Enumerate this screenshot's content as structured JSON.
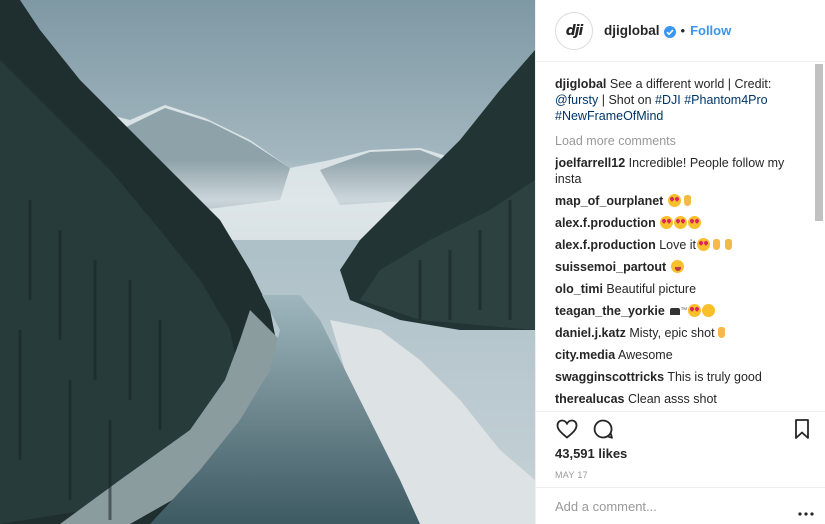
{
  "post": {
    "username": "djiglobal",
    "avatar_text": "dji",
    "follow_label": "Follow",
    "separator": "•",
    "caption_user": "djiglobal",
    "caption_text": "See a different world | Credit:",
    "caption_mention": "@fursty",
    "caption_mid": "| Shot on",
    "caption_tags": [
      "#DJI",
      "#Phantom4Pro",
      "#NewFrameOfMind"
    ],
    "load_more": "Load more comments",
    "likes": "43,591 likes",
    "date": "MAY 17",
    "add_comment_placeholder": "Add a comment..."
  },
  "comments": [
    {
      "user": "joelfarrell12",
      "text": "Incredible! People follow my insta",
      "emoji": []
    },
    {
      "user": "map_of_ourplanet",
      "text": "",
      "emoji": [
        "heart-eyes",
        "ok-hand"
      ]
    },
    {
      "user": "alex.f.production",
      "text": "",
      "emoji": [
        "heart-eyes",
        "heart-eyes",
        "heart-eyes"
      ]
    },
    {
      "user": "alex.f.production",
      "text": "Love it",
      "emoji": [
        "heart-eyes",
        "victory-hand",
        "thumbs-up"
      ]
    },
    {
      "user": "suissemoi_partout",
      "text": "",
      "emoji": [
        "winking-tongue"
      ]
    },
    {
      "user": "olo_timi",
      "text": "Beautiful picture",
      "emoji": []
    },
    {
      "user": "teagan_the_yorkie",
      "text": "",
      "emoji": [
        "top-hat",
        "tm",
        "heart-eyes",
        "screaming-face"
      ]
    },
    {
      "user": "daniel.j.katz",
      "text": "Misty, epic shot",
      "emoji": [
        "ok-hand"
      ]
    },
    {
      "user": "city.media",
      "text": "Awesome",
      "emoji": []
    },
    {
      "user": "swagginscottricks",
      "text": "This is truly good",
      "emoji": []
    },
    {
      "user": "therealucas",
      "text": "Clean asss shot",
      "emoji": []
    }
  ],
  "icons": {
    "like": "heart-outline-icon",
    "comment": "comment-bubble-icon",
    "save": "bookmark-icon",
    "more": "more-dots-icon",
    "verified": "verified-badge-icon"
  },
  "colors": {
    "link": "#003569",
    "follow": "#3897f0",
    "muted": "#999999",
    "text": "#262626"
  }
}
